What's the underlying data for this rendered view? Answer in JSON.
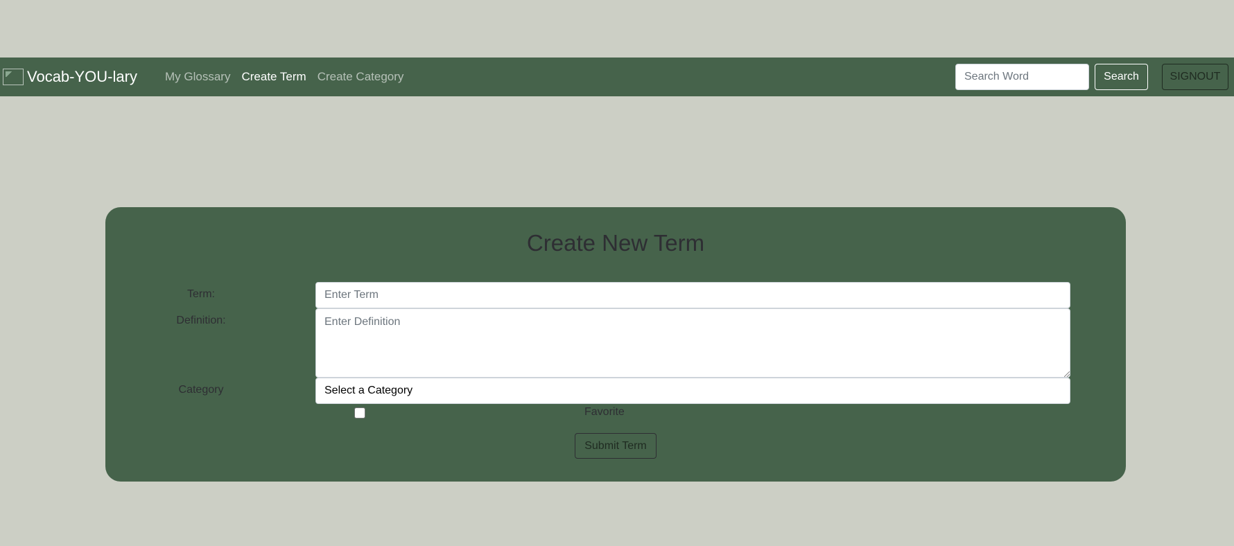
{
  "navbar": {
    "brand": "Vocab-YOU-lary",
    "links": [
      {
        "label": "My Glossary",
        "active": false
      },
      {
        "label": "Create Term",
        "active": true
      },
      {
        "label": "Create Category",
        "active": false
      }
    ],
    "search_placeholder": "Search Word",
    "search_label": "Search",
    "signout_label": "SIGNOUT"
  },
  "form": {
    "title": "Create New Term",
    "term_label": "Term:",
    "term_placeholder": "Enter Term",
    "definition_label": "Definition:",
    "definition_placeholder": "Enter Definition",
    "category_label": "Category",
    "category_selected": "Select a Category",
    "favorite_label": "Favorite",
    "favorite_checked": false,
    "submit_label": "Submit Term"
  },
  "colors": {
    "page_bg": "#cccfc5",
    "nav_bg": "#46634b",
    "card_bg": "#46634b",
    "text_dark": "#2e2e33"
  }
}
